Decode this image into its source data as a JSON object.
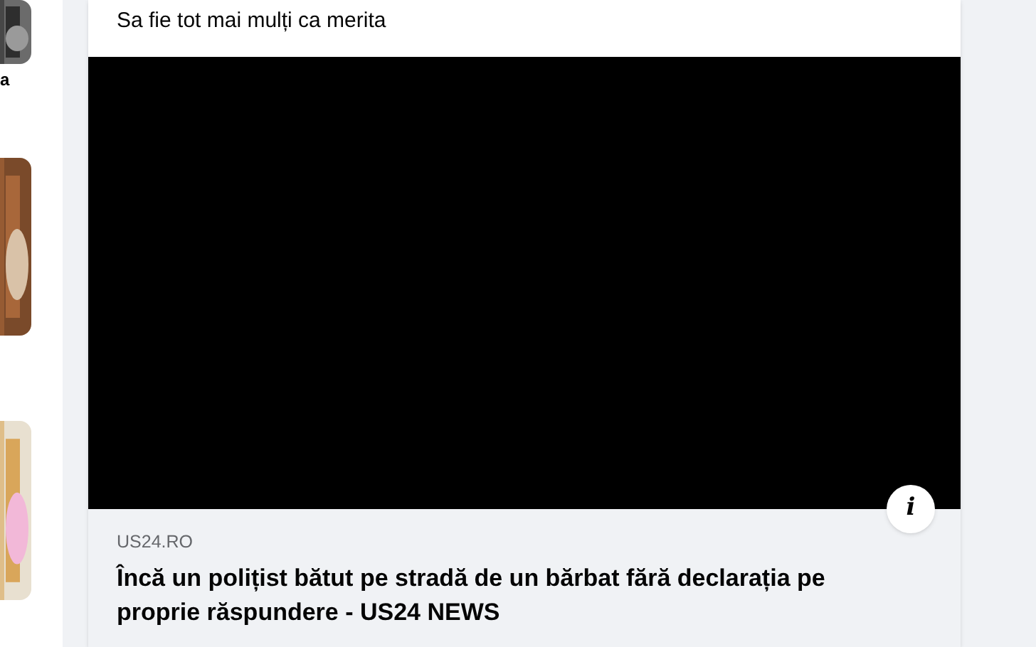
{
  "side_column": {
    "items": [
      {
        "kind": "picture"
      },
      {
        "kind": "caption",
        "text": "a"
      },
      {
        "kind": "picture"
      },
      {
        "kind": "picture"
      }
    ]
  },
  "post": {
    "text": "Sa fie tot mai mulți ca merita",
    "video": {
      "info_button": "i"
    },
    "link_preview": {
      "domain": "US24.RO",
      "title": "Încă un polițist bătut pe stradă de un bărbat fără declarația pe proprie răspundere - US24 NEWS"
    }
  }
}
